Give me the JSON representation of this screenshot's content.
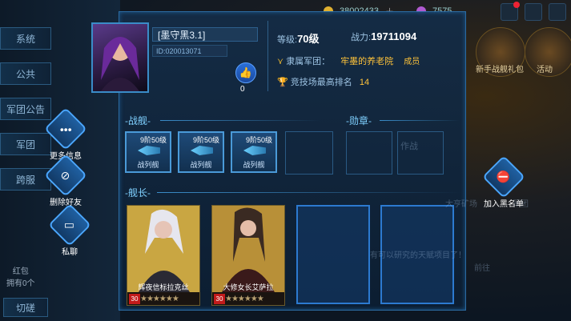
{
  "header": {
    "currency1": "38002433",
    "currency2": "7575"
  },
  "side_tabs": [
    "系统",
    "公共",
    "军团公告",
    "军团",
    "跨服"
  ],
  "side_left_label": "红包\n拥有0个",
  "side_left_button": "切磋",
  "right_promos": {
    "promo1": "新手战舰礼包",
    "promo2": "活动"
  },
  "profile": {
    "name": "[墨守黑3.1]",
    "id": "ID:020013071",
    "likes": "0",
    "level_label": "等级:",
    "level_value": "70级",
    "power_label": "战力:",
    "power_value": "19711094",
    "legion_label": "隶属军团：",
    "legion_name": "牢墨的养老院",
    "legion_role": "成员",
    "arena_label": "竞技场最高排名",
    "arena_rank": "14"
  },
  "sections": {
    "ships": "-战舰-",
    "badges": "-勋章-",
    "captains": "-舰长-"
  },
  "ships": [
    {
      "level": "9阶50级",
      "name": "战列舰"
    },
    {
      "level": "9阶50级",
      "name": "战列舰"
    },
    {
      "level": "9阶50级",
      "name": "战列舰"
    }
  ],
  "captains": [
    {
      "name": "辉夜信标拉克丝",
      "level": "30",
      "stars": "★★★★★★"
    },
    {
      "name": "大修女长艾萨拉",
      "level": "30",
      "stars": "★★★★★★"
    }
  ],
  "actions": {
    "more": "更多信息",
    "remove_friend": "删除好友",
    "private_chat": "私聊",
    "blacklist": "加入黑名单"
  },
  "bg_text": {
    "t1": "作战",
    "t2": "大亨矿场",
    "t3": "军团",
    "t4": "有可以研究的天赋项目了！",
    "t5": "前往"
  }
}
